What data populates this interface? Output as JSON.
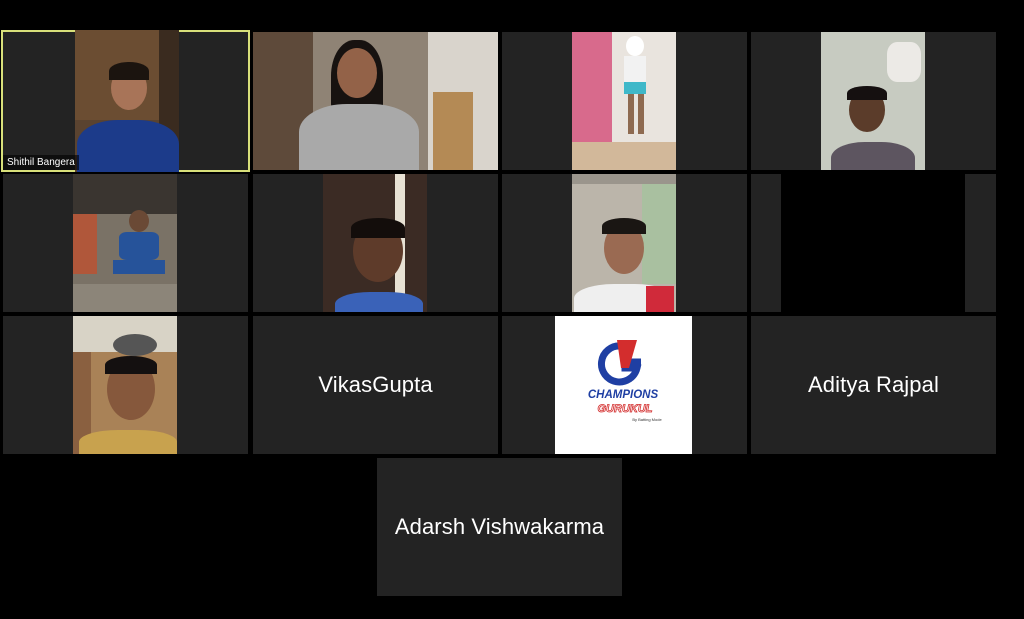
{
  "meeting": {
    "participants": [
      {
        "id": "p1",
        "name": "Shithil Bangera",
        "video": true,
        "active_speaker": true
      },
      {
        "id": "p2",
        "name": "",
        "video": true
      },
      {
        "id": "p3",
        "name": "",
        "video": true
      },
      {
        "id": "p4",
        "name": "",
        "video": true
      },
      {
        "id": "p5",
        "name": "",
        "video": true
      },
      {
        "id": "p6",
        "name": "",
        "video": true
      },
      {
        "id": "p7",
        "name": "",
        "video": true
      },
      {
        "id": "p8",
        "name": "",
        "video": true
      },
      {
        "id": "p9",
        "name": "",
        "video": true
      },
      {
        "id": "p10",
        "name": "VikasGupta",
        "video": false
      },
      {
        "id": "p11",
        "name": "",
        "video": true,
        "logo": true
      },
      {
        "id": "p12",
        "name": "Aditya Rajpal",
        "video": false
      },
      {
        "id": "p13",
        "name": "Adarsh Vishwakarma",
        "video": false
      }
    ]
  },
  "logo": {
    "brand_top": "CHAMPIONS",
    "brand_bottom": "GURUKUL",
    "tagline": "By Batting Mode",
    "accent_blue": "#1f3fa3",
    "accent_red": "#d32d2d"
  },
  "colors": {
    "background": "#000000",
    "tile": "#232323",
    "active_border": "#d8e07a",
    "text": "#ffffff"
  }
}
